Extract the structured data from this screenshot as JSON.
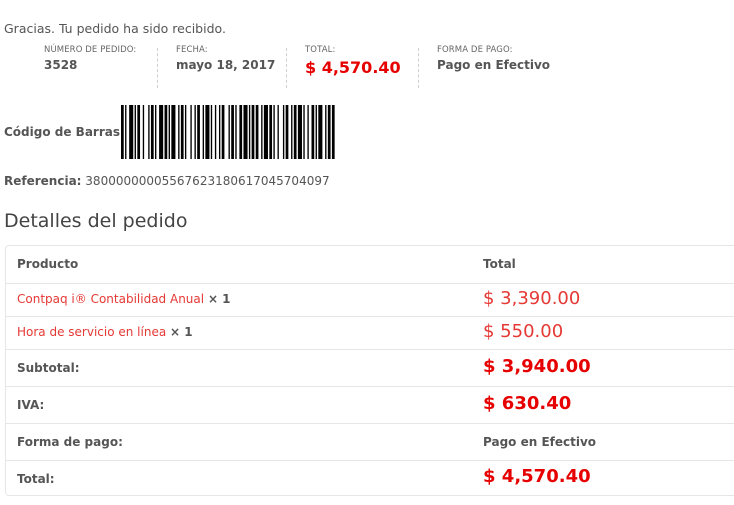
{
  "thanks_message": "Gracias. Tu pedido ha sido recibido.",
  "order_overview": {
    "number_label": "NÚMERO DE PEDIDO:",
    "number_value": "3528",
    "date_label": "FECHA:",
    "date_value": "mayo 18, 2017",
    "total_label": "TOTAL:",
    "total_value": "$ 4,570.40",
    "payment_label": "FORMA DE PAGO:",
    "payment_value": "Pago en Efectivo"
  },
  "barcode": {
    "label": "Código de Barras:"
  },
  "reference": {
    "label": "Referencia:",
    "value": "3800000000556762318061704570409​7"
  },
  "details": {
    "title": "Detalles del pedido",
    "header_product": "Producto",
    "header_total": "Total",
    "items": [
      {
        "name": "Contpaq i® Contabilidad Anual",
        "qty": "× 1",
        "total": "$ 3,390.00"
      },
      {
        "name": "Hora de servicio en línea",
        "qty": "× 1",
        "total": "$ 550.00"
      }
    ],
    "subtotal_label": "Subtotal:",
    "subtotal_value": "$ 3,940.00",
    "iva_label": "IVA:",
    "iva_value": "$ 630.40",
    "payment_label": "Forma de pago:",
    "payment_value": "Pago en Efectivo",
    "total_label": "Total:",
    "total_value": "$ 4,570.40"
  },
  "colors": {
    "accent_red": "#e60000",
    "link_red": "#e53935"
  }
}
